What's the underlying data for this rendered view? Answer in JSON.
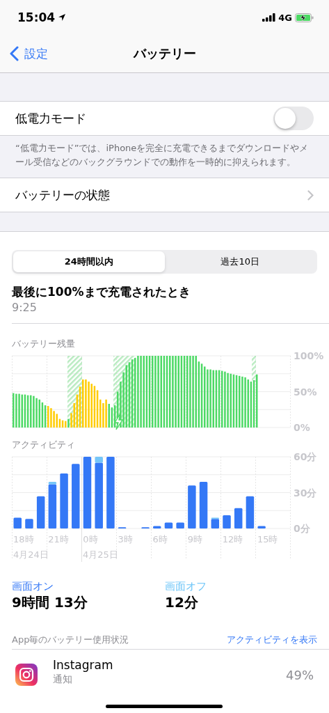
{
  "status_bar": {
    "time": "15:04",
    "network": "4G"
  },
  "nav": {
    "back": "設定",
    "title": "バッテリー"
  },
  "low_power": {
    "label": "低電力モード",
    "on": false,
    "footnote": "“低電力モード”では、iPhoneを完全に充電できるまでダウンロードやメール受信などのバックグラウンドでの動作を一時的に抑えられます。"
  },
  "battery_health": {
    "label": "バッテリーの状態"
  },
  "tabs": [
    {
      "label": "24時間以内",
      "selected": true
    },
    {
      "label": "過去10日",
      "selected": false
    }
  ],
  "last_charged": {
    "title": "最後に100%まで充電されたとき",
    "time": "9:25"
  },
  "battery_level": {
    "chart_data": {
      "type": "bar",
      "title": "バッテリー残量",
      "stacked": true,
      "ylim": [
        0,
        100
      ],
      "yticks": [
        {
          "value": 0,
          "label": "0%"
        },
        {
          "value": 50,
          "label": "50%"
        },
        {
          "value": 100,
          "label": "100%"
        }
      ],
      "series": [
        {
          "color": "#4cd964",
          "values": [
            48,
            47,
            47,
            46,
            46,
            45,
            45,
            44,
            41,
            39,
            35,
            31,
            null,
            null,
            null,
            null,
            null,
            null,
            null,
            12,
            null,
            null,
            null,
            null,
            null,
            null,
            null,
            null,
            null,
            null,
            null,
            null,
            null,
            33,
            28,
            31,
            50,
            64,
            77,
            87,
            91,
            95,
            97,
            100,
            100,
            100,
            100,
            100,
            100,
            100,
            100,
            100,
            100,
            100,
            100,
            100,
            100,
            100,
            100,
            100,
            100,
            100,
            100,
            100,
            92,
            89,
            85,
            81,
            81,
            80,
            80,
            80,
            79,
            78,
            76,
            75,
            74,
            73,
            72,
            71,
            70,
            67,
            64,
            66,
            74
          ]
        },
        {
          "color": "#ffcc00",
          "values": [
            null,
            null,
            null,
            null,
            null,
            null,
            null,
            null,
            null,
            null,
            null,
            null,
            30,
            27,
            23,
            19,
            12,
            10,
            9,
            null,
            20,
            34,
            46,
            57,
            67,
            67,
            64,
            61,
            58,
            52,
            39,
            34,
            39,
            null,
            null,
            null,
            null,
            null,
            null,
            null,
            null,
            null,
            null,
            null,
            null,
            null,
            null,
            null,
            null,
            null,
            null,
            null,
            null,
            null,
            null,
            null,
            null,
            null,
            null,
            null,
            null,
            null,
            null,
            null,
            null,
            null,
            null,
            null,
            null,
            null,
            null,
            null,
            null,
            null,
            null,
            null,
            null,
            null,
            null,
            null,
            null,
            null,
            null,
            null,
            null
          ]
        }
      ]
    }
  },
  "activity": {
    "chart_data": {
      "type": "bar",
      "title": "アクティビティ",
      "stacked": true,
      "ylim": [
        0,
        60
      ],
      "yticks": [
        {
          "value": 0,
          "label": "0分"
        },
        {
          "value": 30,
          "label": "30分"
        },
        {
          "value": 60,
          "label": "60分"
        }
      ],
      "series": [
        {
          "color": "#3478f6",
          "values": [
            9,
            8,
            27,
            37,
            46,
            54,
            60,
            55,
            60,
            1,
            0,
            1,
            2,
            5,
            5,
            36,
            39,
            8,
            11,
            17,
            27,
            2,
            null,
            null
          ]
        },
        {
          "color": "#76c6f8",
          "values": [
            0,
            0,
            0,
            2,
            0,
            0,
            0,
            5,
            0,
            0,
            0,
            0,
            0,
            0,
            0,
            0,
            0,
            1,
            0,
            0,
            0,
            0,
            null,
            null
          ]
        }
      ]
    },
    "hour_labels": [
      "18時",
      "21時",
      "0時",
      "3時",
      "6時",
      "9時",
      "12時",
      "15時"
    ],
    "dates": [
      "4月24日",
      "4月25日"
    ]
  },
  "screen_time": [
    {
      "label": "画面オン",
      "value": "9時間 13分",
      "color": "#3478f6"
    },
    {
      "label": "画面オフ",
      "value": "12分",
      "color": "#6ac4f8"
    }
  ],
  "app_usage": {
    "header": "App毎のバッテリー使用状況",
    "action": "アクティビティを表示",
    "apps": [
      {
        "name": "Instagram",
        "detail": "通知",
        "percent": "49%"
      }
    ]
  }
}
